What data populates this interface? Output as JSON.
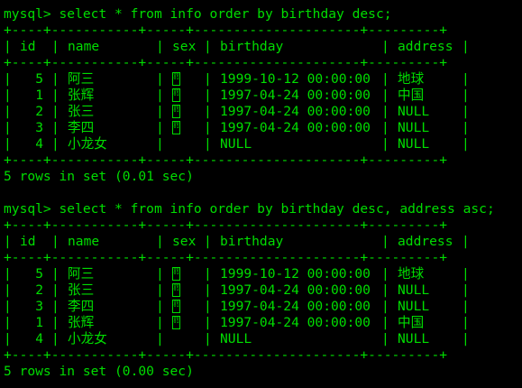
{
  "colors": {
    "background": "#000000",
    "foreground": "#00dd00"
  },
  "terminal": {
    "border_line": "+----+-----------+-----+---------------------+---------+",
    "header": {
      "id": "id",
      "name": "name",
      "sex": "sex",
      "birthday": "birthday",
      "address": "address"
    },
    "queries": [
      {
        "prompt": "mysql> ",
        "command": "select * from info order by birthday desc;",
        "rows": [
          {
            "id": "5",
            "name": "阿三",
            "sex_glyph": "00 01",
            "birthday": "1999-10-12 00:00:00",
            "address": "地球"
          },
          {
            "id": "1",
            "name": "张辉",
            "sex_glyph": "00 01",
            "birthday": "1997-04-24 00:00:00",
            "address": "中国"
          },
          {
            "id": "2",
            "name": "张三",
            "sex_glyph": "00 01",
            "birthday": "1997-04-24 00:00:00",
            "address": "NULL"
          },
          {
            "id": "3",
            "name": "李四",
            "sex_glyph": "00 01",
            "birthday": "1997-04-24 00:00:00",
            "address": "NULL"
          },
          {
            "id": "4",
            "name": "小龙女",
            "sex_glyph": "",
            "birthday": "NULL",
            "address": "NULL"
          }
        ],
        "result": "5 rows in set (0.01 sec)"
      },
      {
        "prompt": "mysql> ",
        "command": "select * from info order by birthday desc, address asc;",
        "rows": [
          {
            "id": "5",
            "name": "阿三",
            "sex_glyph": "00 01",
            "birthday": "1999-10-12 00:00:00",
            "address": "地球"
          },
          {
            "id": "2",
            "name": "张三",
            "sex_glyph": "00 01",
            "birthday": "1997-04-24 00:00:00",
            "address": "NULL"
          },
          {
            "id": "3",
            "name": "李四",
            "sex_glyph": "00 01",
            "birthday": "1997-04-24 00:00:00",
            "address": "NULL"
          },
          {
            "id": "1",
            "name": "张辉",
            "sex_glyph": "00 01",
            "birthday": "1997-04-24 00:00:00",
            "address": "中国"
          },
          {
            "id": "4",
            "name": "小龙女",
            "sex_glyph": "",
            "birthday": "NULL",
            "address": "NULL"
          }
        ],
        "result": "5 rows in set (0.00 sec)"
      }
    ]
  }
}
